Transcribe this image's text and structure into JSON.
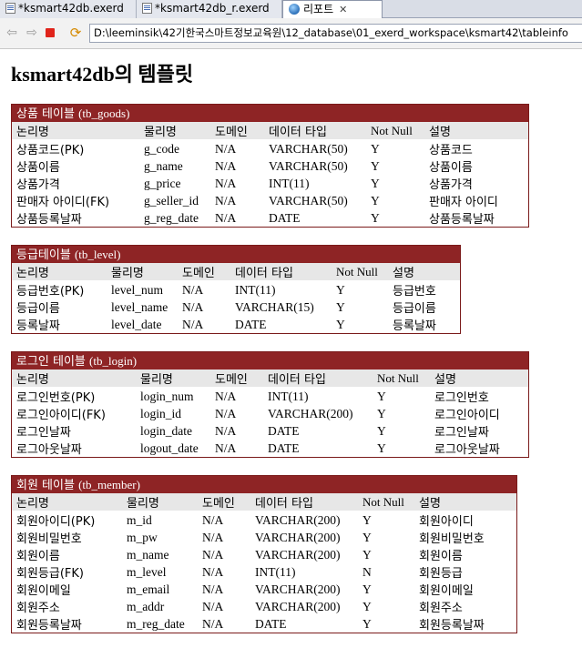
{
  "tabs": [
    {
      "label": "*ksmart42db.exerd",
      "active": false
    },
    {
      "label": "*ksmart42db_r.exerd",
      "active": false
    },
    {
      "label": "리포트",
      "active": true
    }
  ],
  "address": "D:\\leeminsik\\42기한국스마트정보교육원\\12_database\\01_exerd_workspace\\ksmart42\\tableinfo",
  "page_title": "ksmart42db의 템플릿",
  "columns": [
    "논리명",
    "물리명",
    "도메인",
    "데이터 타입",
    "Not Null",
    "설명"
  ],
  "colors": {
    "caption_bg": "#8e2425",
    "header_bg": "#e7e7e7"
  },
  "tables": [
    {
      "caption_ko": "상품 테이블",
      "caption_en": "(tb_goods)",
      "rows": [
        [
          "상품코드(PK)",
          "g_code",
          "N/A",
          "VARCHAR(50)",
          "Y",
          "상품코드"
        ],
        [
          "상품이름",
          "g_name",
          "N/A",
          "VARCHAR(50)",
          "Y",
          "상품이름"
        ],
        [
          "상품가격",
          "g_price",
          "N/A",
          "INT(11)",
          "Y",
          "상품가격"
        ],
        [
          "판매자 아이디(FK)",
          "g_seller_id",
          "N/A",
          "VARCHAR(50)",
          "Y",
          "판매자 아이디"
        ],
        [
          "상품등록날짜",
          "g_reg_date",
          "N/A",
          "DATE",
          "Y",
          "상품등록날짜"
        ]
      ]
    },
    {
      "caption_ko": "등급테이블",
      "caption_en": "(tb_level)",
      "rows": [
        [
          "등급번호(PK)",
          "level_num",
          "N/A",
          "INT(11)",
          "Y",
          "등급번호"
        ],
        [
          "등급이름",
          "level_name",
          "N/A",
          "VARCHAR(15)",
          "Y",
          "등급이름"
        ],
        [
          "등록날짜",
          "level_date",
          "N/A",
          "DATE",
          "Y",
          "등록날짜"
        ]
      ]
    },
    {
      "caption_ko": "로그인 테이블",
      "caption_en": "(tb_login)",
      "rows": [
        [
          "로그인번호(PK)",
          "login_num",
          "N/A",
          "INT(11)",
          "Y",
          "로그인번호"
        ],
        [
          "로그인아이디(FK)",
          "login_id",
          "N/A",
          "VARCHAR(200)",
          "Y",
          "로그인아이디"
        ],
        [
          "로그인날짜",
          "login_date",
          "N/A",
          "DATE",
          "Y",
          "로그인날짜"
        ],
        [
          "로그아웃날짜",
          "logout_date",
          "N/A",
          "DATE",
          "Y",
          "로그아웃날짜"
        ]
      ]
    },
    {
      "caption_ko": "회원 테이블",
      "caption_en": "(tb_member)",
      "rows": [
        [
          "회원아이디(PK)",
          "m_id",
          "N/A",
          "VARCHAR(200)",
          "Y",
          "회원아이디"
        ],
        [
          "회원비밀번호",
          "m_pw",
          "N/A",
          "VARCHAR(200)",
          "Y",
          "회원비밀번호"
        ],
        [
          "회원이름",
          "m_name",
          "N/A",
          "VARCHAR(200)",
          "Y",
          "회원이름"
        ],
        [
          "회원등급(FK)",
          "m_level",
          "N/A",
          "INT(11)",
          "N",
          "회원등급"
        ],
        [
          "회원이메일",
          "m_email",
          "N/A",
          "VARCHAR(200)",
          "Y",
          "회원이메일"
        ],
        [
          "회원주소",
          "m_addr",
          "N/A",
          "VARCHAR(200)",
          "Y",
          "회원주소"
        ],
        [
          "회원등록날짜",
          "m_reg_date",
          "N/A",
          "DATE",
          "Y",
          "회원등록날짜"
        ]
      ]
    }
  ]
}
